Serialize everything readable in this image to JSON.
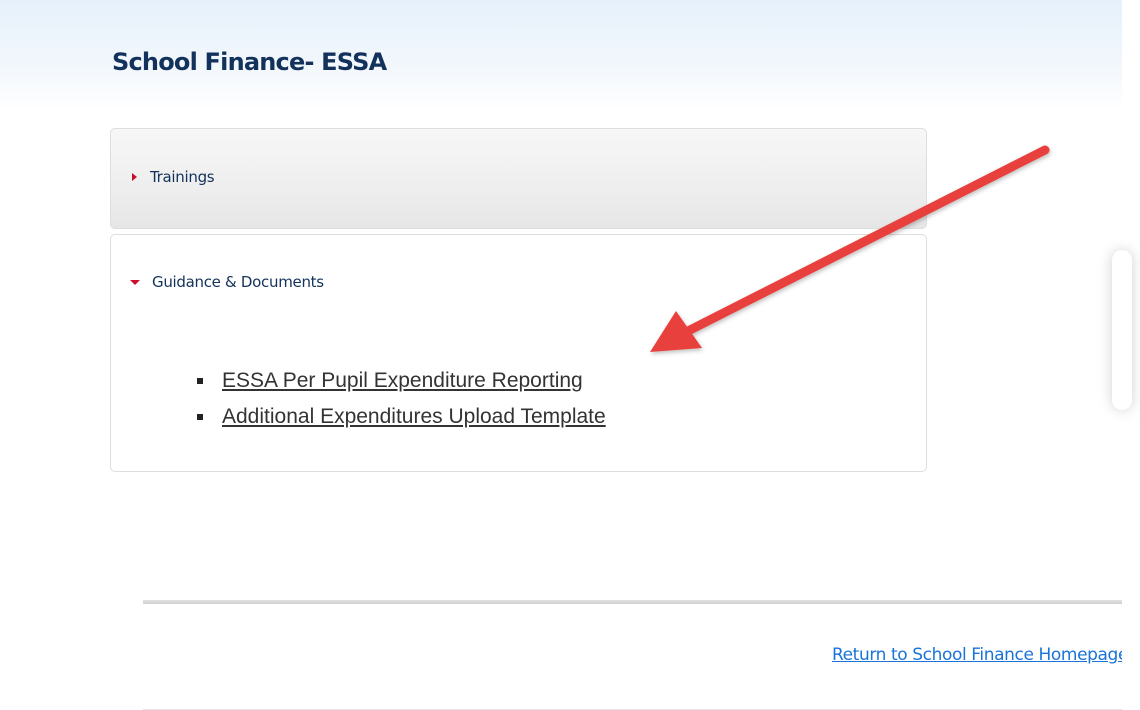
{
  "page": {
    "title": "School Finance- ESSA"
  },
  "accordion": {
    "panels": [
      {
        "label": "Trainings",
        "state": "collapsed",
        "icon": "caret-right-icon"
      },
      {
        "label": "Guidance & Documents",
        "state": "expanded",
        "icon": "caret-down-icon",
        "links": [
          "ESSA Per Pupil Expenditure Reporting",
          "Additional Expenditures Upload Template"
        ]
      }
    ]
  },
  "footer": {
    "return_link": "Return to School Finance Homepage"
  },
  "colors": {
    "title": "#13325b",
    "caret": "#c8102e",
    "link": "#1a73d9",
    "annotation_arrow": "#e8413c"
  },
  "annotation": {
    "icon": "red-arrow-icon"
  }
}
